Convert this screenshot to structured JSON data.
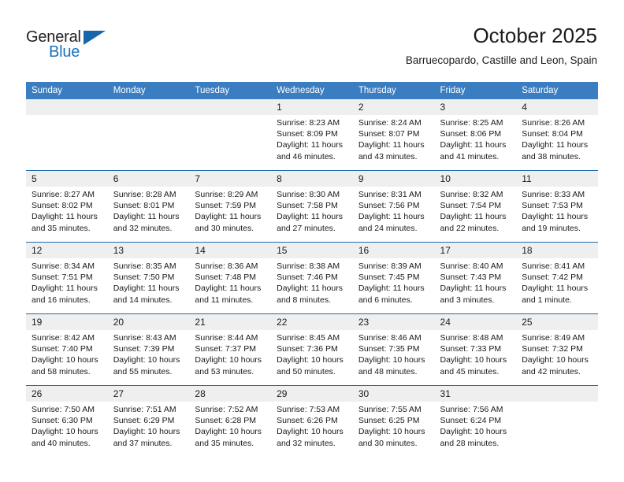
{
  "brand": {
    "name_top": "General",
    "name_bottom": "Blue",
    "triangle_icon": "triangle-icon",
    "color_dark": "#231f20",
    "color_blue": "#1673c0"
  },
  "header": {
    "title": "October 2025",
    "subtitle": "Barruecopardo, Castille and Leon, Spain"
  },
  "theme": {
    "header_bg": "#3b7dc1",
    "row_divider": "#1f6cb0",
    "daynum_bg": "#efefef",
    "text": "#1a1a1a"
  },
  "weekdays": [
    "Sunday",
    "Monday",
    "Tuesday",
    "Wednesday",
    "Thursday",
    "Friday",
    "Saturday"
  ],
  "labels": {
    "sunrise_prefix": "Sunrise:",
    "sunset_prefix": "Sunset:",
    "daylight_prefix": "Daylight:"
  },
  "weeks": [
    [
      {
        "day": "",
        "empty": true
      },
      {
        "day": "",
        "empty": true
      },
      {
        "day": "",
        "empty": true
      },
      {
        "day": "1",
        "sunrise": "Sunrise: 8:23 AM",
        "sunset": "Sunset: 8:09 PM",
        "daylight_line1": "Daylight: 11 hours",
        "daylight_line2": "and 46 minutes."
      },
      {
        "day": "2",
        "sunrise": "Sunrise: 8:24 AM",
        "sunset": "Sunset: 8:07 PM",
        "daylight_line1": "Daylight: 11 hours",
        "daylight_line2": "and 43 minutes."
      },
      {
        "day": "3",
        "sunrise": "Sunrise: 8:25 AM",
        "sunset": "Sunset: 8:06 PM",
        "daylight_line1": "Daylight: 11 hours",
        "daylight_line2": "and 41 minutes."
      },
      {
        "day": "4",
        "sunrise": "Sunrise: 8:26 AM",
        "sunset": "Sunset: 8:04 PM",
        "daylight_line1": "Daylight: 11 hours",
        "daylight_line2": "and 38 minutes."
      }
    ],
    [
      {
        "day": "5",
        "sunrise": "Sunrise: 8:27 AM",
        "sunset": "Sunset: 8:02 PM",
        "daylight_line1": "Daylight: 11 hours",
        "daylight_line2": "and 35 minutes."
      },
      {
        "day": "6",
        "sunrise": "Sunrise: 8:28 AM",
        "sunset": "Sunset: 8:01 PM",
        "daylight_line1": "Daylight: 11 hours",
        "daylight_line2": "and 32 minutes."
      },
      {
        "day": "7",
        "sunrise": "Sunrise: 8:29 AM",
        "sunset": "Sunset: 7:59 PM",
        "daylight_line1": "Daylight: 11 hours",
        "daylight_line2": "and 30 minutes."
      },
      {
        "day": "8",
        "sunrise": "Sunrise: 8:30 AM",
        "sunset": "Sunset: 7:58 PM",
        "daylight_line1": "Daylight: 11 hours",
        "daylight_line2": "and 27 minutes."
      },
      {
        "day": "9",
        "sunrise": "Sunrise: 8:31 AM",
        "sunset": "Sunset: 7:56 PM",
        "daylight_line1": "Daylight: 11 hours",
        "daylight_line2": "and 24 minutes."
      },
      {
        "day": "10",
        "sunrise": "Sunrise: 8:32 AM",
        "sunset": "Sunset: 7:54 PM",
        "daylight_line1": "Daylight: 11 hours",
        "daylight_line2": "and 22 minutes."
      },
      {
        "day": "11",
        "sunrise": "Sunrise: 8:33 AM",
        "sunset": "Sunset: 7:53 PM",
        "daylight_line1": "Daylight: 11 hours",
        "daylight_line2": "and 19 minutes."
      }
    ],
    [
      {
        "day": "12",
        "sunrise": "Sunrise: 8:34 AM",
        "sunset": "Sunset: 7:51 PM",
        "daylight_line1": "Daylight: 11 hours",
        "daylight_line2": "and 16 minutes."
      },
      {
        "day": "13",
        "sunrise": "Sunrise: 8:35 AM",
        "sunset": "Sunset: 7:50 PM",
        "daylight_line1": "Daylight: 11 hours",
        "daylight_line2": "and 14 minutes."
      },
      {
        "day": "14",
        "sunrise": "Sunrise: 8:36 AM",
        "sunset": "Sunset: 7:48 PM",
        "daylight_line1": "Daylight: 11 hours",
        "daylight_line2": "and 11 minutes."
      },
      {
        "day": "15",
        "sunrise": "Sunrise: 8:38 AM",
        "sunset": "Sunset: 7:46 PM",
        "daylight_line1": "Daylight: 11 hours",
        "daylight_line2": "and 8 minutes."
      },
      {
        "day": "16",
        "sunrise": "Sunrise: 8:39 AM",
        "sunset": "Sunset: 7:45 PM",
        "daylight_line1": "Daylight: 11 hours",
        "daylight_line2": "and 6 minutes."
      },
      {
        "day": "17",
        "sunrise": "Sunrise: 8:40 AM",
        "sunset": "Sunset: 7:43 PM",
        "daylight_line1": "Daylight: 11 hours",
        "daylight_line2": "and 3 minutes."
      },
      {
        "day": "18",
        "sunrise": "Sunrise: 8:41 AM",
        "sunset": "Sunset: 7:42 PM",
        "daylight_line1": "Daylight: 11 hours",
        "daylight_line2": "and 1 minute."
      }
    ],
    [
      {
        "day": "19",
        "sunrise": "Sunrise: 8:42 AM",
        "sunset": "Sunset: 7:40 PM",
        "daylight_line1": "Daylight: 10 hours",
        "daylight_line2": "and 58 minutes."
      },
      {
        "day": "20",
        "sunrise": "Sunrise: 8:43 AM",
        "sunset": "Sunset: 7:39 PM",
        "daylight_line1": "Daylight: 10 hours",
        "daylight_line2": "and 55 minutes."
      },
      {
        "day": "21",
        "sunrise": "Sunrise: 8:44 AM",
        "sunset": "Sunset: 7:37 PM",
        "daylight_line1": "Daylight: 10 hours",
        "daylight_line2": "and 53 minutes."
      },
      {
        "day": "22",
        "sunrise": "Sunrise: 8:45 AM",
        "sunset": "Sunset: 7:36 PM",
        "daylight_line1": "Daylight: 10 hours",
        "daylight_line2": "and 50 minutes."
      },
      {
        "day": "23",
        "sunrise": "Sunrise: 8:46 AM",
        "sunset": "Sunset: 7:35 PM",
        "daylight_line1": "Daylight: 10 hours",
        "daylight_line2": "and 48 minutes."
      },
      {
        "day": "24",
        "sunrise": "Sunrise: 8:48 AM",
        "sunset": "Sunset: 7:33 PM",
        "daylight_line1": "Daylight: 10 hours",
        "daylight_line2": "and 45 minutes."
      },
      {
        "day": "25",
        "sunrise": "Sunrise: 8:49 AM",
        "sunset": "Sunset: 7:32 PM",
        "daylight_line1": "Daylight: 10 hours",
        "daylight_line2": "and 42 minutes."
      }
    ],
    [
      {
        "day": "26",
        "sunrise": "Sunrise: 7:50 AM",
        "sunset": "Sunset: 6:30 PM",
        "daylight_line1": "Daylight: 10 hours",
        "daylight_line2": "and 40 minutes."
      },
      {
        "day": "27",
        "sunrise": "Sunrise: 7:51 AM",
        "sunset": "Sunset: 6:29 PM",
        "daylight_line1": "Daylight: 10 hours",
        "daylight_line2": "and 37 minutes."
      },
      {
        "day": "28",
        "sunrise": "Sunrise: 7:52 AM",
        "sunset": "Sunset: 6:28 PM",
        "daylight_line1": "Daylight: 10 hours",
        "daylight_line2": "and 35 minutes."
      },
      {
        "day": "29",
        "sunrise": "Sunrise: 7:53 AM",
        "sunset": "Sunset: 6:26 PM",
        "daylight_line1": "Daylight: 10 hours",
        "daylight_line2": "and 32 minutes."
      },
      {
        "day": "30",
        "sunrise": "Sunrise: 7:55 AM",
        "sunset": "Sunset: 6:25 PM",
        "daylight_line1": "Daylight: 10 hours",
        "daylight_line2": "and 30 minutes."
      },
      {
        "day": "31",
        "sunrise": "Sunrise: 7:56 AM",
        "sunset": "Sunset: 6:24 PM",
        "daylight_line1": "Daylight: 10 hours",
        "daylight_line2": "and 28 minutes."
      },
      {
        "day": "",
        "empty": true
      }
    ]
  ]
}
